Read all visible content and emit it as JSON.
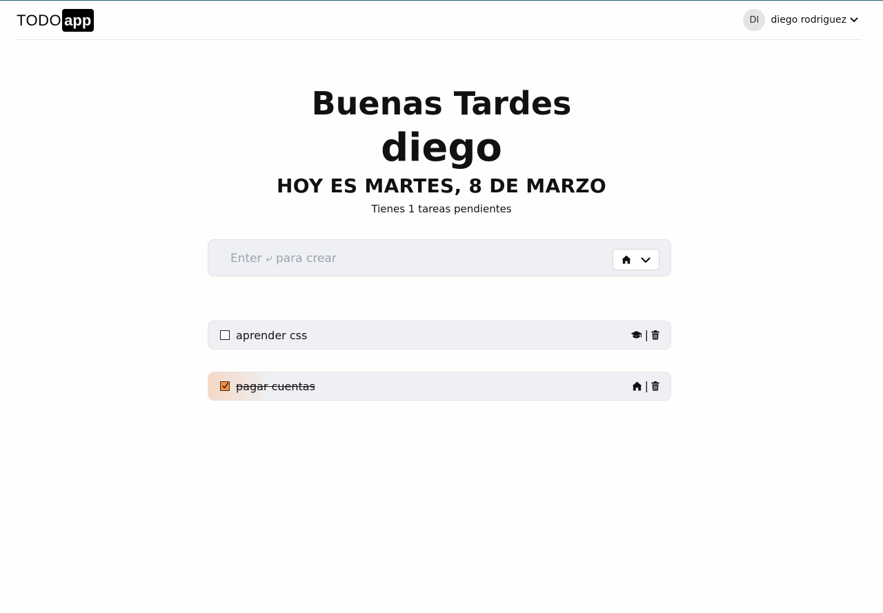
{
  "header": {
    "logo_text": "TODO",
    "logo_badge": "app",
    "user": {
      "initials": "DI",
      "name": "diego rodriguez"
    }
  },
  "hero": {
    "greeting": "Buenas Tardes",
    "username": "diego",
    "date": "HOY ES MARTES, 8 DE MARZO",
    "pending": "Tienes 1 tareas pendientes"
  },
  "create": {
    "placeholder": "Enter ⤶ para crear",
    "category_icon": "home-icon"
  },
  "tasks": [
    {
      "label": "aprender css",
      "done": false,
      "category_icon": "graduation-cap-icon"
    },
    {
      "label": "pagar cuentas",
      "done": true,
      "category_icon": "home-icon"
    }
  ],
  "colors": {
    "accent": "#fb8c3c",
    "card_bg": "#eff0f3",
    "page_bg": "#fefefc"
  }
}
